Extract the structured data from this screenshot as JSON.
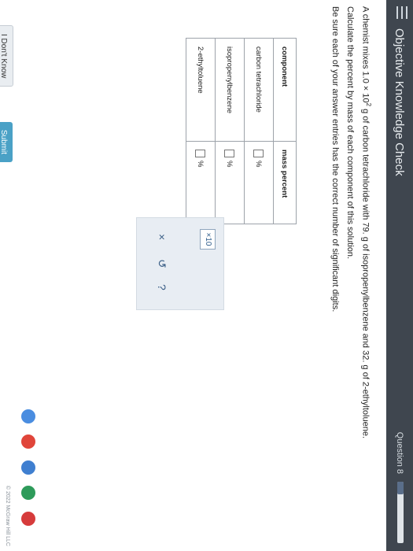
{
  "header": {
    "title": "Objective Knowledge Check",
    "question": "Question 8",
    "progress": 0.2
  },
  "prompt": {
    "line1_pre": "A chemist mixes 1.0 × 10",
    "line1_exp": "2",
    "line1_post": " g of carbon tetrachloride with 79. g of isopropenylbenzene and 32. g of 2-ethyltoluene.",
    "line2": "Calculate the percent by mass of each component of this solution.",
    "line3": "Be sure each of your answer entries has the correct number of significant digits."
  },
  "table": {
    "headers": [
      "component",
      "mass percent"
    ],
    "rows": [
      {
        "component": "carbon tetrachloride",
        "value": "",
        "unit": "%"
      },
      {
        "component": "isopropenylbenzene",
        "value": "",
        "unit": "%"
      },
      {
        "component": "2-ethyltoluene",
        "value": "",
        "unit": "%"
      }
    ]
  },
  "tools": {
    "sci_notation": "×10",
    "clear": "×",
    "undo": "↺",
    "help": "?"
  },
  "buttons": {
    "dont_know": "I Don't Know",
    "submit": "Submit"
  },
  "footer": {
    "copyright": "© 2022 McGraw Hill LLC"
  },
  "colors": {
    "topbar": "#3f464f",
    "submit": "#4aa1c6",
    "panel": "#e8edf3"
  }
}
